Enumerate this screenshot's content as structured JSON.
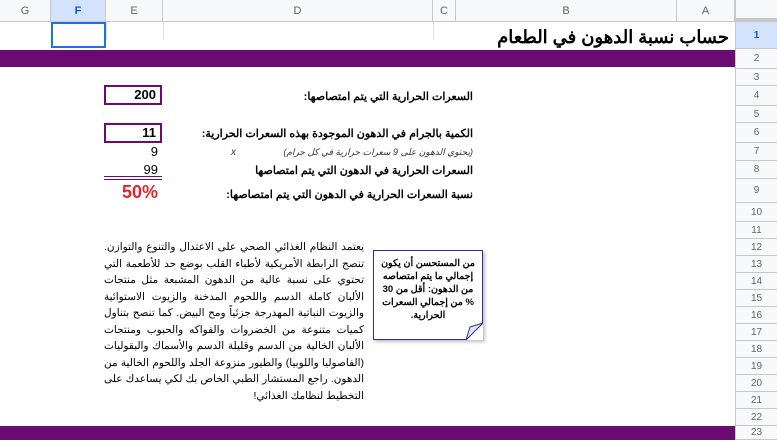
{
  "columns": [
    "G",
    "F",
    "E",
    "D",
    "C",
    "B",
    "A"
  ],
  "selected_column": "F",
  "rows": [
    "1",
    "2",
    "3",
    "4",
    "5",
    "6",
    "7",
    "8",
    "9",
    "10",
    "11",
    "12",
    "13",
    "14",
    "15",
    "16",
    "17",
    "18",
    "19",
    "20",
    "21",
    "22",
    "23"
  ],
  "selected_row": "1",
  "sheet": {
    "title": "حساب نسبة الدهون في الطعام",
    "calories_label": "السعرات الحرارية التي يتم امتصاصها:",
    "calories_value": "200",
    "fat_grams_label": "الكمية بالجرام في الدهون الموجودة بهذه السعرات الحرارية:",
    "fat_grams_value": "11",
    "fat_note": "(يحتوي الدهون على 9 سعرات حرارية في كل جرام)",
    "multiply_sign": "x",
    "fat_cal_per_gram": "9",
    "fat_calories_label": "السعرات الحرارية في الدهون التي يتم امتصاصها",
    "fat_calories_value": "99",
    "percent_label": "نسبة السعرات الحرارية في الدهون التي يتم امتصاصها:",
    "percent_value": "50%",
    "paragraph": "يعتمد النظام الغذائي الصحي على الاعتدال والتنوع والتوازن. تنصح الرابطة الأمريكية لأطباء القلب بوضع حد للأطعمة التي تحتوي على نسبة عالية من الدهون المشبعة مثل منتجات الألبان كاملة الدسم واللحوم المدخنة والزيوت الاستوائية والزيوت النباتية المهدرجة جزئياً ومح البيض. كما تنصح بتناول كميات متنوعة من الخضروات والفواكه والحبوب ومنتجات الألبان الخالية من الدسم وقليلة الدسم والأسماك والبقوليات (الفاصوليا واللوبيا) والطيور منزوعة الجلد واللحوم الخالية من الدهون. راجع المستشار الطبي الخاص بك لكي يساعدك على التخطيط لنظامك الغذائي!",
    "note": "من المستحسن أن يكون إجمالي ما يتم امتصاصه من الدهون: أقل من 30 % من إجمالي السعرات الحرارية."
  },
  "colors": {
    "band": "#6a0a72",
    "percent": "#e0262d",
    "selection": "#1a73e8"
  }
}
